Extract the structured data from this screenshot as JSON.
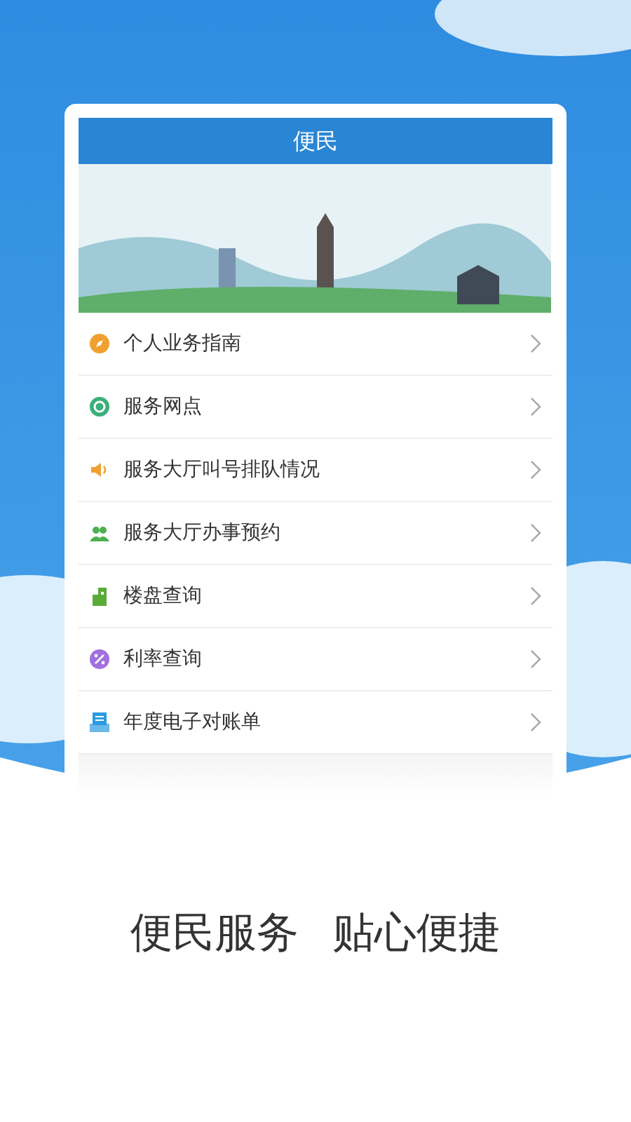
{
  "header": {
    "title": "便民"
  },
  "items": [
    {
      "label": "个人业务指南",
      "kind": "compass",
      "color": "#f0a030"
    },
    {
      "label": "服务网点",
      "kind": "network",
      "color": "#3bb07a"
    },
    {
      "label": "服务大厅叫号排队情况",
      "kind": "speaker",
      "color": "#f0a030"
    },
    {
      "label": "服务大厅办事预约",
      "kind": "people",
      "color": "#4caf50"
    },
    {
      "label": "楼盘查询",
      "kind": "building",
      "color": "#5aab3a"
    },
    {
      "label": "利率查询",
      "kind": "percent",
      "color": "#a070e0"
    },
    {
      "label": "年度电子对账单",
      "kind": "bill",
      "color": "#2a9be0"
    }
  ],
  "slogan": [
    "便民服务",
    "贴心便捷"
  ]
}
